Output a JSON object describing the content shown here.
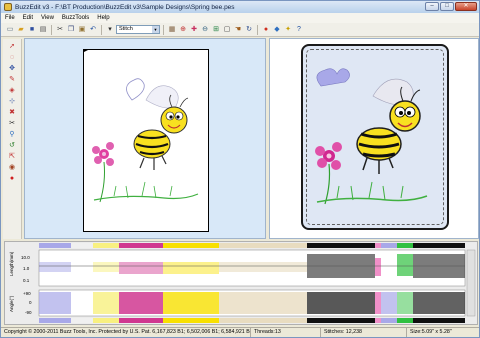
{
  "window": {
    "title": "BuzzEdit v3 - F:\\BT Production\\BuzzEdit v3\\Sample Designs\\Spring bee.pes"
  },
  "winbtns": {
    "minimize": "–",
    "maximize": "□",
    "close": "✕"
  },
  "menu": [
    "File",
    "Edit",
    "View",
    "BuzzTools",
    "Help"
  ],
  "toolbar": {
    "stitch_select": "Stitch"
  },
  "graph": {
    "length_label": "Length(mm)",
    "angle_label": "Angle(°)",
    "length_ticks": [
      "10.0",
      "1.0",
      "0.1"
    ],
    "angle_ticks": [
      "+90",
      "0",
      "-90"
    ]
  },
  "status": {
    "copyright": "Copyright © 2000-2011 Buzz Tools, Inc. Protected by U.S. Pat. 6,167,823 B1; 6,502,006 B1; 6,584,921 B2",
    "threads": "Threads:13",
    "stitches": "Stitches: 12,238",
    "size": "Size:5.09\" x 5.28\""
  },
  "colors": {
    "pane_left_bg": "#d8e8f8",
    "thread_bar": [
      "#a8a8e8",
      "#f0f0f0",
      "#f8f080",
      "#d03890",
      "#f8e000",
      "#e8dcc0",
      "#101010",
      "#f090c8",
      "#30c040",
      "#303030"
    ]
  }
}
